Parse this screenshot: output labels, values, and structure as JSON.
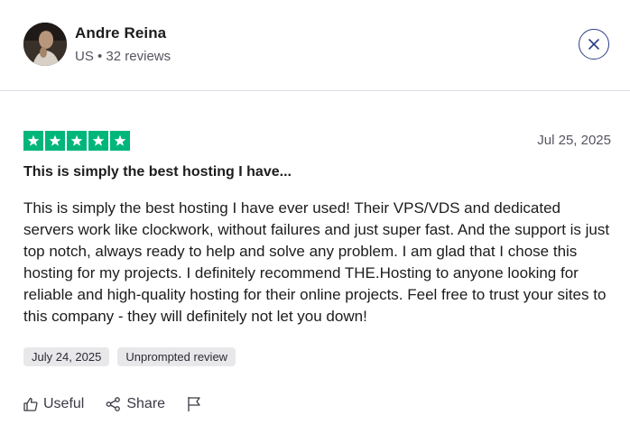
{
  "user": {
    "name": "Andre Reina",
    "meta": "US • 32 reviews"
  },
  "review": {
    "rating": 5,
    "date": "Jul 25, 2025",
    "title": "This is simply the best hosting I have...",
    "body": "This is simply the best hosting I have ever used! Their VPS/VDS and dedicated servers work like clockwork, without failures and just super fast. And the support is just top notch, always ready to help and solve any problem. I am glad that I chose this hosting for my projects. I definitely recommend THE.Hosting to anyone looking for reliable and high-quality hosting for their online projects. Feel free to trust your sites to this company - they will definitely not let you down!",
    "tags": [
      "July 24, 2025",
      "Unprompted review"
    ]
  },
  "actions": {
    "useful_label": "Useful",
    "share_label": "Share"
  },
  "colors": {
    "star_green": "#00b67a",
    "close_blue": "#2c3e85",
    "tag_bg": "#e8e8ea"
  },
  "icons": [
    "close-icon",
    "star-icon",
    "thumbs-up-icon",
    "share-icon",
    "flag-icon"
  ]
}
